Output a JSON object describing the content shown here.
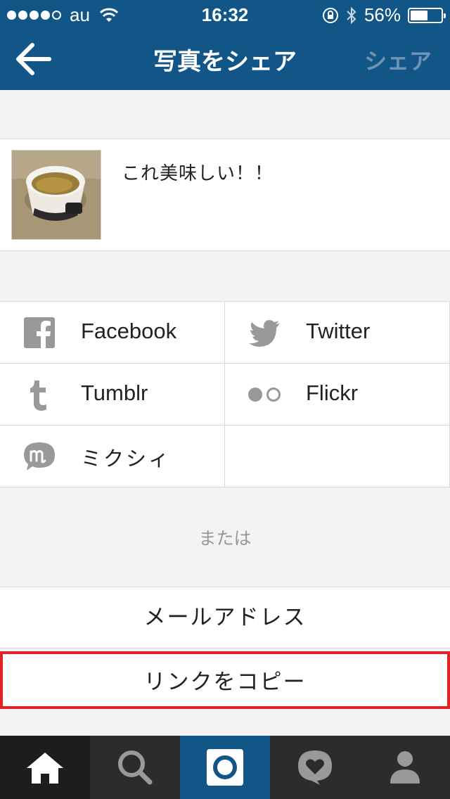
{
  "status_bar": {
    "carrier": "au",
    "time": "16:32",
    "battery": "56%",
    "battery_level": 0.56
  },
  "nav": {
    "title": "写真をシェア",
    "share_label": "シェア"
  },
  "post": {
    "caption": "これ美味しい！！"
  },
  "share_targets": [
    {
      "label": "Facebook",
      "icon": "facebook-icon"
    },
    {
      "label": "Twitter",
      "icon": "twitter-icon"
    },
    {
      "label": "Tumblr",
      "icon": "tumblr-icon"
    },
    {
      "label": "Flickr",
      "icon": "flickr-icon"
    },
    {
      "label": "ミクシィ",
      "icon": "mixi-icon"
    }
  ],
  "or_text": "または",
  "actions": {
    "email": "メールアドレス",
    "copy_link": "リンクをコピー"
  },
  "tabs": [
    "home-icon",
    "search-icon",
    "camera-icon",
    "activity-heart-icon",
    "profile-icon"
  ],
  "colors": {
    "brand": "#125688",
    "highlight": "#e32228"
  }
}
